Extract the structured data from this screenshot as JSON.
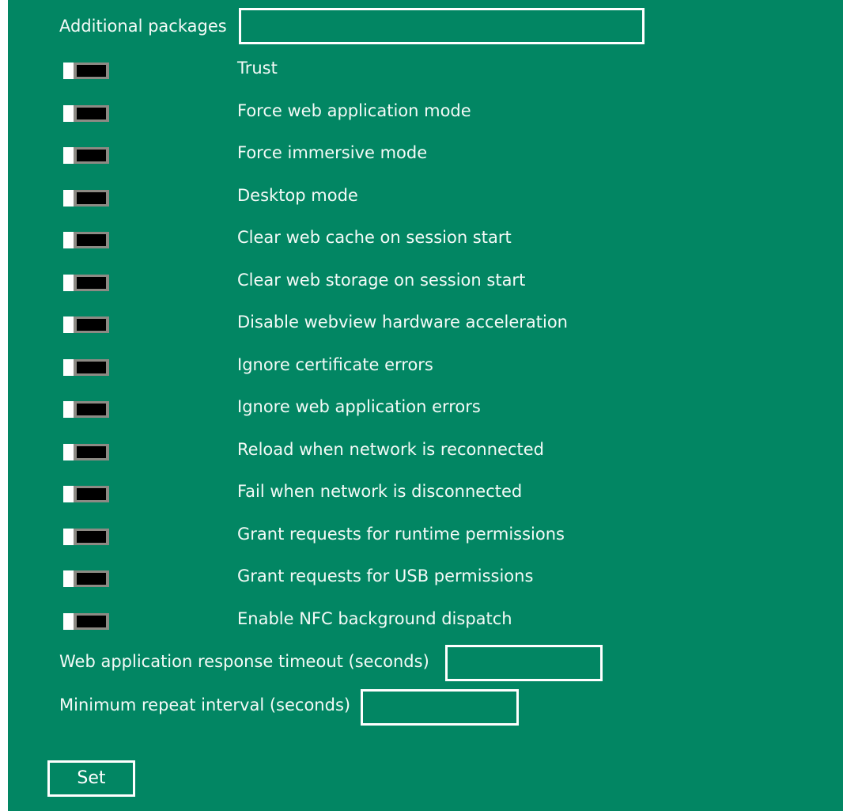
{
  "colors": {
    "background": "#028663",
    "text": "#ffffff",
    "toggle_knob": "#ffffff",
    "toggle_track": "#000000",
    "toggle_frame": "#8d8a84"
  },
  "additional_packages": {
    "label": "Additional packages",
    "value": ""
  },
  "toggles": [
    {
      "label": "Trust",
      "on": false
    },
    {
      "label": "Force web application mode",
      "on": false
    },
    {
      "label": "Force immersive mode",
      "on": false
    },
    {
      "label": "Desktop mode",
      "on": false
    },
    {
      "label": "Clear web cache on session start",
      "on": false
    },
    {
      "label": "Clear web storage on session start",
      "on": false
    },
    {
      "label": "Disable webview hardware acceleration",
      "on": false
    },
    {
      "label": "Ignore certificate errors",
      "on": false
    },
    {
      "label": "Ignore web application errors",
      "on": false
    },
    {
      "label": "Reload when network is reconnected",
      "on": false
    },
    {
      "label": "Fail when network is disconnected",
      "on": false
    },
    {
      "label": "Grant requests for runtime permissions",
      "on": false
    },
    {
      "label": "Grant requests for USB permissions",
      "on": false
    },
    {
      "label": "Enable NFC background dispatch",
      "on": false
    }
  ],
  "response_timeout": {
    "label": "Web application response timeout (seconds)",
    "value": ""
  },
  "repeat_interval": {
    "label": "Minimum repeat interval (seconds)",
    "value": ""
  },
  "set_button": {
    "label": "Set"
  }
}
